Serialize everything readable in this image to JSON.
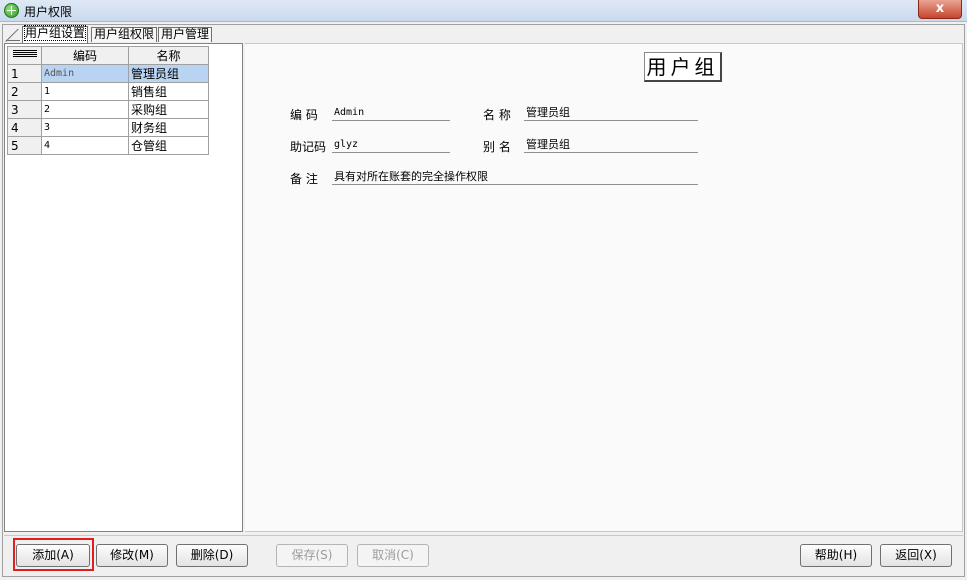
{
  "window": {
    "title": "用户权限",
    "close_label": "x"
  },
  "tabs": [
    {
      "label": "用户组设置",
      "active": true
    },
    {
      "label": "用户组权限",
      "active": false
    },
    {
      "label": "用户管理",
      "active": false
    }
  ],
  "grid": {
    "headers": [
      "编码",
      "名称"
    ],
    "rows": [
      {
        "num": "1",
        "code": "Admin",
        "name": "管理员组"
      },
      {
        "num": "2",
        "code": "1",
        "name": "销售组"
      },
      {
        "num": "3",
        "code": "2",
        "name": "采购组"
      },
      {
        "num": "4",
        "code": "3",
        "name": "财务组"
      },
      {
        "num": "5",
        "code": "4",
        "name": "仓管组"
      }
    ],
    "selected_row": 0
  },
  "detail": {
    "heading": "用户组",
    "code_label": "编  码",
    "code_value": "Admin",
    "name_label": "名  称",
    "name_value": "管理员组",
    "mnemonic_label": "助记码",
    "mnemonic_value": "glyz",
    "alias_label": "别  名",
    "alias_value": "管理员组",
    "remark_label": "备  注",
    "remark_value": "具有对所在账套的完全操作权限"
  },
  "buttons": {
    "add": "添加(A)",
    "edit": "修改(M)",
    "delete": "删除(D)",
    "save": "保存(S)",
    "cancel": "取消(C)",
    "help": "帮助(H)",
    "back": "返回(X)"
  }
}
